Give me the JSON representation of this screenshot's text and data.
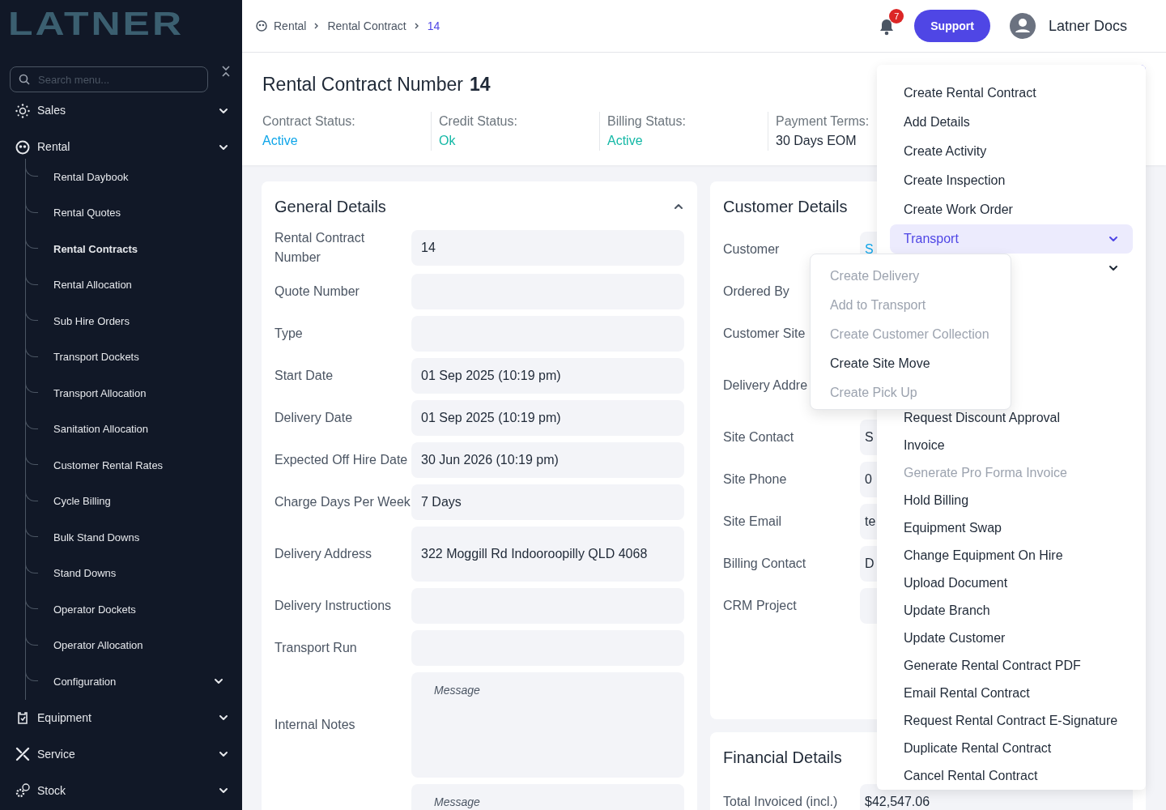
{
  "sidebar": {
    "logo": "LATNER",
    "search": {
      "placeholder": "Search menu..."
    },
    "items": [
      {
        "label": "Sales"
      },
      {
        "label": "Rental",
        "children": [
          {
            "label": "Rental Daybook",
            "selected": false
          },
          {
            "label": "Rental Quotes",
            "selected": false
          },
          {
            "label": "Rental Contracts",
            "selected": true
          },
          {
            "label": "Rental Allocation",
            "selected": false
          },
          {
            "label": "Sub Hire Orders",
            "selected": false
          },
          {
            "label": "Transport Dockets",
            "selected": false
          },
          {
            "label": "Transport Allocation",
            "selected": false
          },
          {
            "label": "Sanitation Allocation",
            "selected": false
          },
          {
            "label": "Customer Rental Rates",
            "selected": false
          },
          {
            "label": "Cycle Billing",
            "selected": false
          },
          {
            "label": "Bulk Stand Downs",
            "selected": false
          },
          {
            "label": "Stand Downs",
            "selected": false
          },
          {
            "label": "Operator Dockets",
            "selected": false
          },
          {
            "label": "Operator Allocation",
            "selected": false
          },
          {
            "label": "Configuration",
            "selected": false,
            "kind": "group"
          }
        ]
      },
      {
        "label": "Equipment"
      },
      {
        "label": "Service"
      },
      {
        "label": "Stock"
      }
    ]
  },
  "topbar": {
    "breadcrumb": [
      {
        "label": "Rental",
        "current": false
      },
      {
        "label": "Rental Contract",
        "current": false
      },
      {
        "label": "14",
        "current": true
      }
    ],
    "notifications": "7",
    "support_button": "Support",
    "user": "Latner Docs"
  },
  "page_header": {
    "title": "Rental Contract Number",
    "number": "14",
    "statuses": [
      {
        "label": "Contract Status:",
        "value": "Active",
        "color": "#0ea5e9"
      },
      {
        "label": "Credit Status:",
        "value": "Ok",
        "color": "#14b8a6"
      },
      {
        "label": "Billing Status:",
        "value": "Active",
        "color": "#14b8a6"
      },
      {
        "label": "Payment Terms:",
        "value": "30 Days EOM",
        "color": "#1f2937"
      }
    ]
  },
  "general_details": {
    "title": "General Details",
    "expanded": true,
    "fields": [
      {
        "label": "Rental Contract Number",
        "kind": "input",
        "value": "14"
      },
      {
        "label": "Quote Number",
        "kind": "input"
      },
      {
        "label": "Type",
        "kind": "input"
      },
      {
        "label": "Start Date",
        "kind": "input",
        "value": "01 Sep 2025 (10:19 pm)"
      },
      {
        "label": "Delivery Date",
        "kind": "input",
        "value": "01 Sep 2025 (10:19 pm)"
      },
      {
        "label": "Expected Off Hire Date",
        "kind": "input",
        "value": "30 Jun 2026 (10:19 pm)"
      },
      {
        "label": "Charge Days Per Week",
        "kind": "input",
        "value": "7 Days"
      },
      {
        "label": "Delivery Address",
        "kind": "input",
        "value": "322 Moggill Rd Indooroopilly QLD 4068"
      },
      {
        "label": "Delivery Instructions",
        "kind": "input"
      },
      {
        "label": "Transport Run",
        "kind": "input"
      },
      {
        "label": "Internal Notes",
        "kind": "textarea",
        "placeholder": "Message"
      },
      {
        "kind": "textarea",
        "placeholder": "Message"
      }
    ]
  },
  "customer_details": {
    "title": "Customer Details",
    "fields": [
      {
        "label": "Customer",
        "kind": "link",
        "value": "S"
      },
      {
        "label": "Ordered By",
        "kind": "covered"
      },
      {
        "label": "Customer Site",
        "kind": "covered"
      },
      {
        "label": "Delivery Addre",
        "kind": "covered_tall"
      },
      {
        "label": "Site Contact",
        "kind": "input",
        "value": "S"
      },
      {
        "label": "Site Phone",
        "kind": "input",
        "value": "0"
      },
      {
        "label": "Site Email",
        "kind": "input",
        "value": "te"
      },
      {
        "label": "Billing Contact",
        "kind": "input",
        "value": "D"
      },
      {
        "label": "CRM Project",
        "kind": "input"
      }
    ]
  },
  "financial_details": {
    "title": "Financial Details",
    "fields": [
      {
        "label": "Total Invoiced (incl.)",
        "kind": "input",
        "value": "$42,547.06"
      }
    ]
  },
  "actions_menu": {
    "items": [
      {
        "label": "Create Rental Contract",
        "selected": false,
        "disabled": false
      },
      {
        "label": "Add Details",
        "selected": false,
        "disabled": false
      },
      {
        "label": "Create Activity",
        "selected": false,
        "disabled": false
      },
      {
        "label": "Create Inspection",
        "selected": false,
        "disabled": false
      },
      {
        "label": "Create Work Order",
        "selected": false,
        "disabled": false
      },
      {
        "label": "Transport",
        "kind": "submenu",
        "selected": true,
        "disabled": false,
        "expanded": true,
        "children": [
          {
            "label": "Create Delivery",
            "disabled": true
          },
          {
            "label": "Add to Transport",
            "disabled": true
          },
          {
            "label": "Create Customer Collection",
            "disabled": true
          },
          {
            "label": "Create Site Move",
            "disabled": false
          },
          {
            "label": "Create Pick Up",
            "disabled": true
          }
        ]
      },
      {
        "kind": "submenu",
        "selected": false,
        "disabled": false
      },
      {
        "label": "Request Discount Approval",
        "selected": false,
        "disabled": false
      },
      {
        "label": "Invoice",
        "selected": false,
        "disabled": false
      },
      {
        "label": "Generate Pro Forma Invoice",
        "selected": false,
        "disabled": true
      },
      {
        "label": "Hold Billing",
        "selected": false,
        "disabled": false
      },
      {
        "label": "Equipment Swap",
        "selected": false,
        "disabled": false
      },
      {
        "label": "Change Equipment On Hire",
        "selected": false,
        "disabled": false
      },
      {
        "label": "Upload Document",
        "selected": false,
        "disabled": false
      },
      {
        "label": "Update Branch",
        "selected": false,
        "disabled": false
      },
      {
        "label": "Update Customer",
        "selected": false,
        "disabled": false
      },
      {
        "label": "Generate Rental Contract PDF",
        "selected": false,
        "disabled": false
      },
      {
        "label": "Email Rental Contract",
        "selected": false,
        "disabled": false
      },
      {
        "label": "Request Rental Contract E-Signature",
        "selected": false,
        "disabled": false
      },
      {
        "label": "Duplicate Rental Contract",
        "selected": false,
        "disabled": false
      },
      {
        "label": "Cancel Rental Contract",
        "selected": false,
        "disabled": false
      }
    ]
  }
}
